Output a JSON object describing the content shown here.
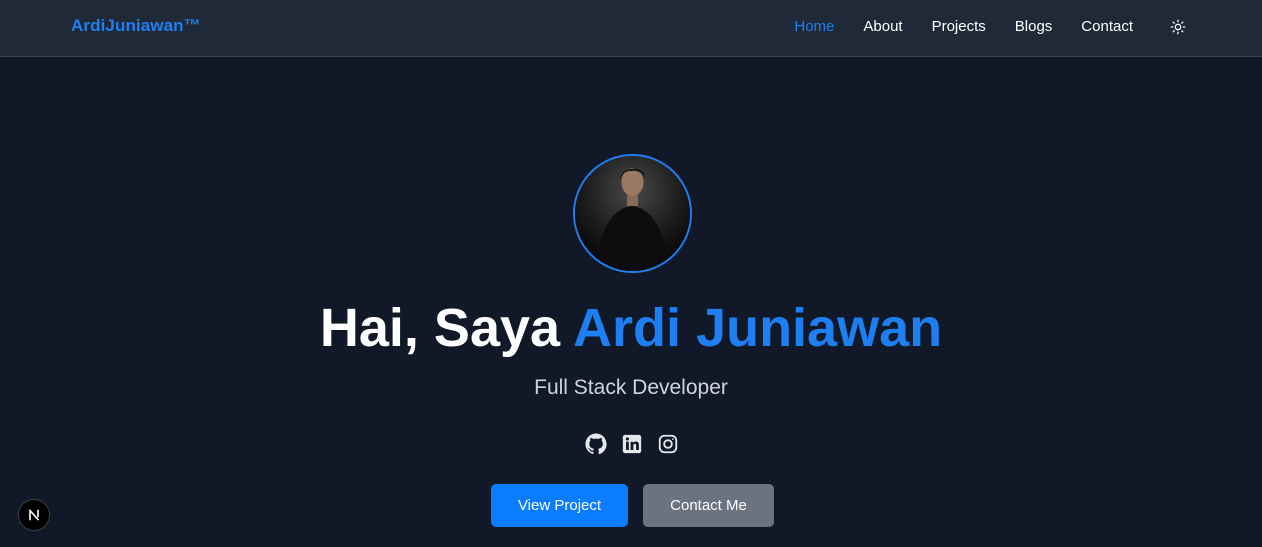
{
  "colors": {
    "accent": "#1d7ff2",
    "background": "#111827",
    "navbar": "#1f2937",
    "secondary_button": "#6b7280"
  },
  "navbar": {
    "brand": "ArdiJuniawan™",
    "links": [
      {
        "label": "Home",
        "active": true
      },
      {
        "label": "About",
        "active": false
      },
      {
        "label": "Projects",
        "active": false
      },
      {
        "label": "Blogs",
        "active": false
      },
      {
        "label": "Contact",
        "active": false
      }
    ],
    "theme_toggle_icon": "sun-icon"
  },
  "hero": {
    "avatar_icon": "profile-photo",
    "greeting": "Hai, Saya",
    "name": "Ardi Juniawan",
    "subtitle": "Full Stack Developer",
    "socials": [
      {
        "icon": "github-icon"
      },
      {
        "icon": "linkedin-icon"
      },
      {
        "icon": "instagram-icon"
      }
    ],
    "primary_button": "View Project",
    "secondary_button": "Contact Me"
  },
  "dev_badge": {
    "label": "N"
  }
}
